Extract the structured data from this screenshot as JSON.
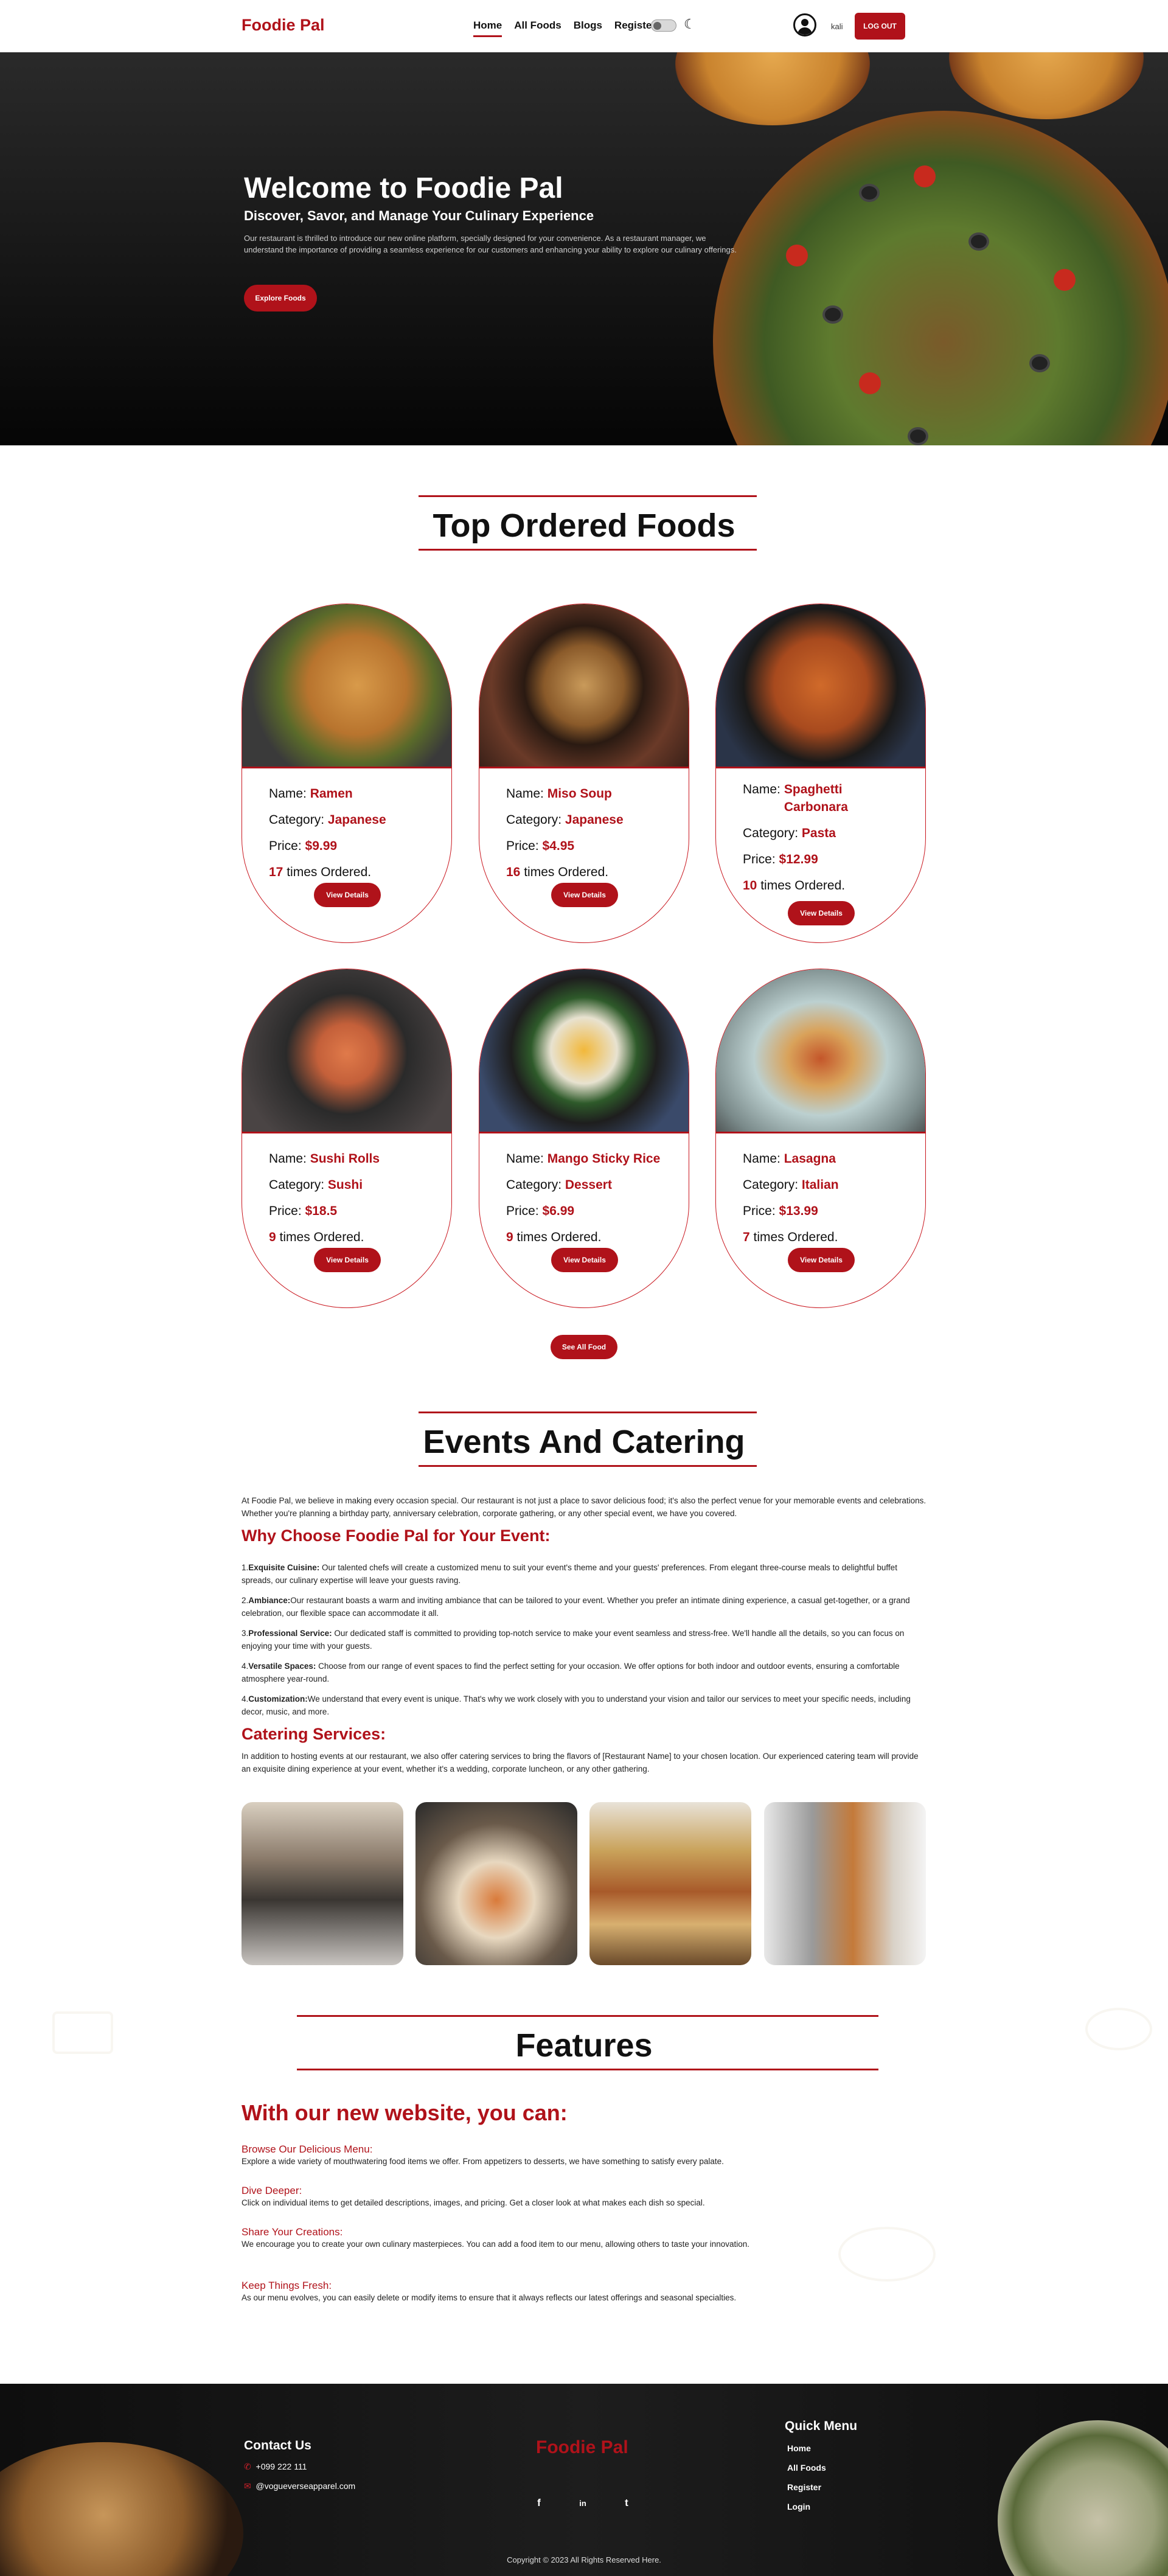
{
  "nav": {
    "brand": "Foodie Pal",
    "links": [
      "Home",
      "All Foods",
      "Blogs",
      "Register"
    ],
    "username": "kali",
    "logout": "LOG OUT",
    "moon_icon": "moon-icon",
    "avatar_icon": "user-avatar-icon"
  },
  "hero": {
    "title": "Welcome to Foodie Pal",
    "subtitle": "Discover, Savor, and Manage Your Culinary Experience",
    "body": "Our restaurant is thrilled to introduce our new online platform, specially designed for your convenience. As a restaurant manager, we understand the importance of providing a seamless experience for our customers and enhancing your ability to explore our culinary offerings.",
    "button": "Explore Foods"
  },
  "top_foods": {
    "title": "Top Ordered Foods",
    "name_label": "Name:",
    "category_label": "Category:",
    "price_label": "Price:",
    "ordered_suffix": "times Ordered.",
    "details_button": "View Details",
    "items": [
      {
        "name": "Ramen",
        "category": "Japanese",
        "price": "$9.99",
        "orders": "17"
      },
      {
        "name": "Miso Soup",
        "category": "Japanese",
        "price": "$4.95",
        "orders": "16"
      },
      {
        "name": "Spaghetti Carbonara",
        "category": "Pasta",
        "price": "$12.99",
        "orders": "10"
      },
      {
        "name": "Sushi Rolls",
        "category": "Sushi",
        "price": "$18.5",
        "orders": "9"
      },
      {
        "name": "Mango Sticky Rice",
        "category": "Dessert",
        "price": "$6.99",
        "orders": "9"
      },
      {
        "name": "Lasagna",
        "category": "Italian",
        "price": "$13.99",
        "orders": "7"
      }
    ],
    "see_all": "See All Food"
  },
  "events": {
    "title": "Events And Catering",
    "intro": "At Foodie Pal, we believe in making every occasion special. Our restaurant is not just a place to savor delicious food; it's also the perfect venue for your memorable events and celebrations. Whether you're planning a birthday party, anniversary celebration, corporate gathering, or any other special event, we have you covered.",
    "why_title": "Why Choose Foodie Pal for Your Event:",
    "points": [
      {
        "num": "1.",
        "head": "Exquisite Cuisine:",
        "text": " Our talented chefs will create a customized menu to suit your event's theme and your guests' preferences. From elegant three-course meals to delightful buffet spreads, our culinary expertise will leave your guests raving."
      },
      {
        "num": "2.",
        "head": "Ambiance:",
        "text": "Our restaurant boasts a warm and inviting ambiance that can be tailored to your event. Whether you prefer an intimate dining experience, a casual get-together, or a grand celebration, our flexible space can accommodate it all."
      },
      {
        "num": "3.",
        "head": "Professional Service:",
        "text": " Our dedicated staff is committed to providing top-notch service to make your event seamless and stress-free. We'll handle all the details, so you can focus on enjoying your time with your guests."
      },
      {
        "num": "4.",
        "head": "Versatile Spaces:",
        "text": " Choose from our range of event spaces to find the perfect setting for your occasion. We offer options for both indoor and outdoor events, ensuring a comfortable atmosphere year-round."
      },
      {
        "num": "4.",
        "head": "Customization:",
        "text": "We understand that every event is unique. That's why we work closely with you to understand your vision and tailor our services to meet your specific needs, including decor, music, and more."
      }
    ],
    "catering_title": "Catering Services:",
    "catering_text": "In addition to hosting events at our restaurant, we also offer catering services to bring the flavors of [Restaurant Name] to your chosen location. Our experienced catering team will provide an exquisite dining experience at your event, whether it's a wedding, corporate luncheon, or any other gathering."
  },
  "features": {
    "title": "Features",
    "heading": "With our new website, you can:",
    "items": [
      {
        "head": "Browse Our Delicious Menu:",
        "text": "Explore a wide variety of mouthwatering food items we offer. From appetizers to desserts, we have something to satisfy every palate."
      },
      {
        "head": "Dive Deeper:",
        "text": "Click on individual items to get detailed descriptions, images, and pricing. Get a closer look at what makes each dish so special."
      },
      {
        "head": "Share Your Creations:",
        "text": "We encourage you to create your own culinary masterpieces. You can add a food item to our menu, allowing others to taste your innovation."
      },
      {
        "head": "Keep Things Fresh:",
        "text": "As our menu evolves, you can easily delete or modify items to ensure that it always reflects our latest offerings and seasonal specialties."
      }
    ]
  },
  "footer": {
    "contact_title": "Contact Us",
    "phone": "+099 222 111",
    "email": "@vogueverseapparel.com",
    "brand": "Foodie Pal",
    "quick_title": "Quick Menu",
    "quick_links": [
      "Home",
      "All Foods",
      "Register",
      "Login"
    ],
    "social": [
      "f",
      "in",
      "t"
    ],
    "copyright": "Copyright © 2023 All Rights Reserved Here."
  },
  "colors": {
    "accent": "#b0121a",
    "hero_bg": "#1a1a1a",
    "footer_bg": "#141414"
  }
}
